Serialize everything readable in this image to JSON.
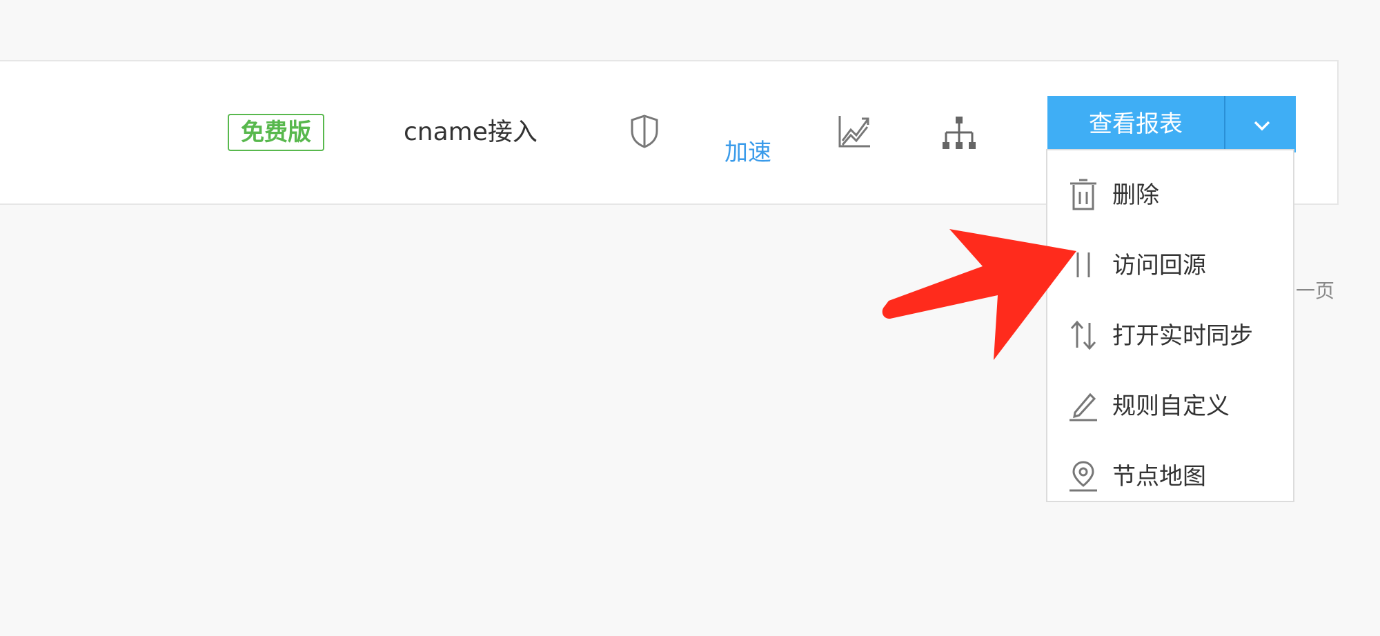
{
  "row": {
    "plan_badge": "免费版",
    "access_type": "cname接入",
    "accelerate_label": "加速"
  },
  "icons": {
    "shield": "shield-icon",
    "chart": "line-chart-icon",
    "sitemap": "sitemap-icon",
    "caret": "chevron-down-icon"
  },
  "actions": {
    "report_button": "查看报表"
  },
  "dropdown": {
    "items": [
      {
        "label": "删除",
        "icon": "trash-icon"
      },
      {
        "label": "访问回源",
        "icon": "pause-icon"
      },
      {
        "label": "打开实时同步",
        "icon": "sync-arrows-icon"
      },
      {
        "label": "规则自定义",
        "icon": "pencil-icon"
      },
      {
        "label": "节点地图",
        "icon": "map-pin-icon"
      }
    ]
  },
  "pagination": {
    "partial_text": "一页"
  },
  "colors": {
    "badge_green": "#58b84d",
    "accent_blue": "#3faef5",
    "link_blue": "#3a9bea",
    "annotation_red": "#ff2b1c"
  }
}
